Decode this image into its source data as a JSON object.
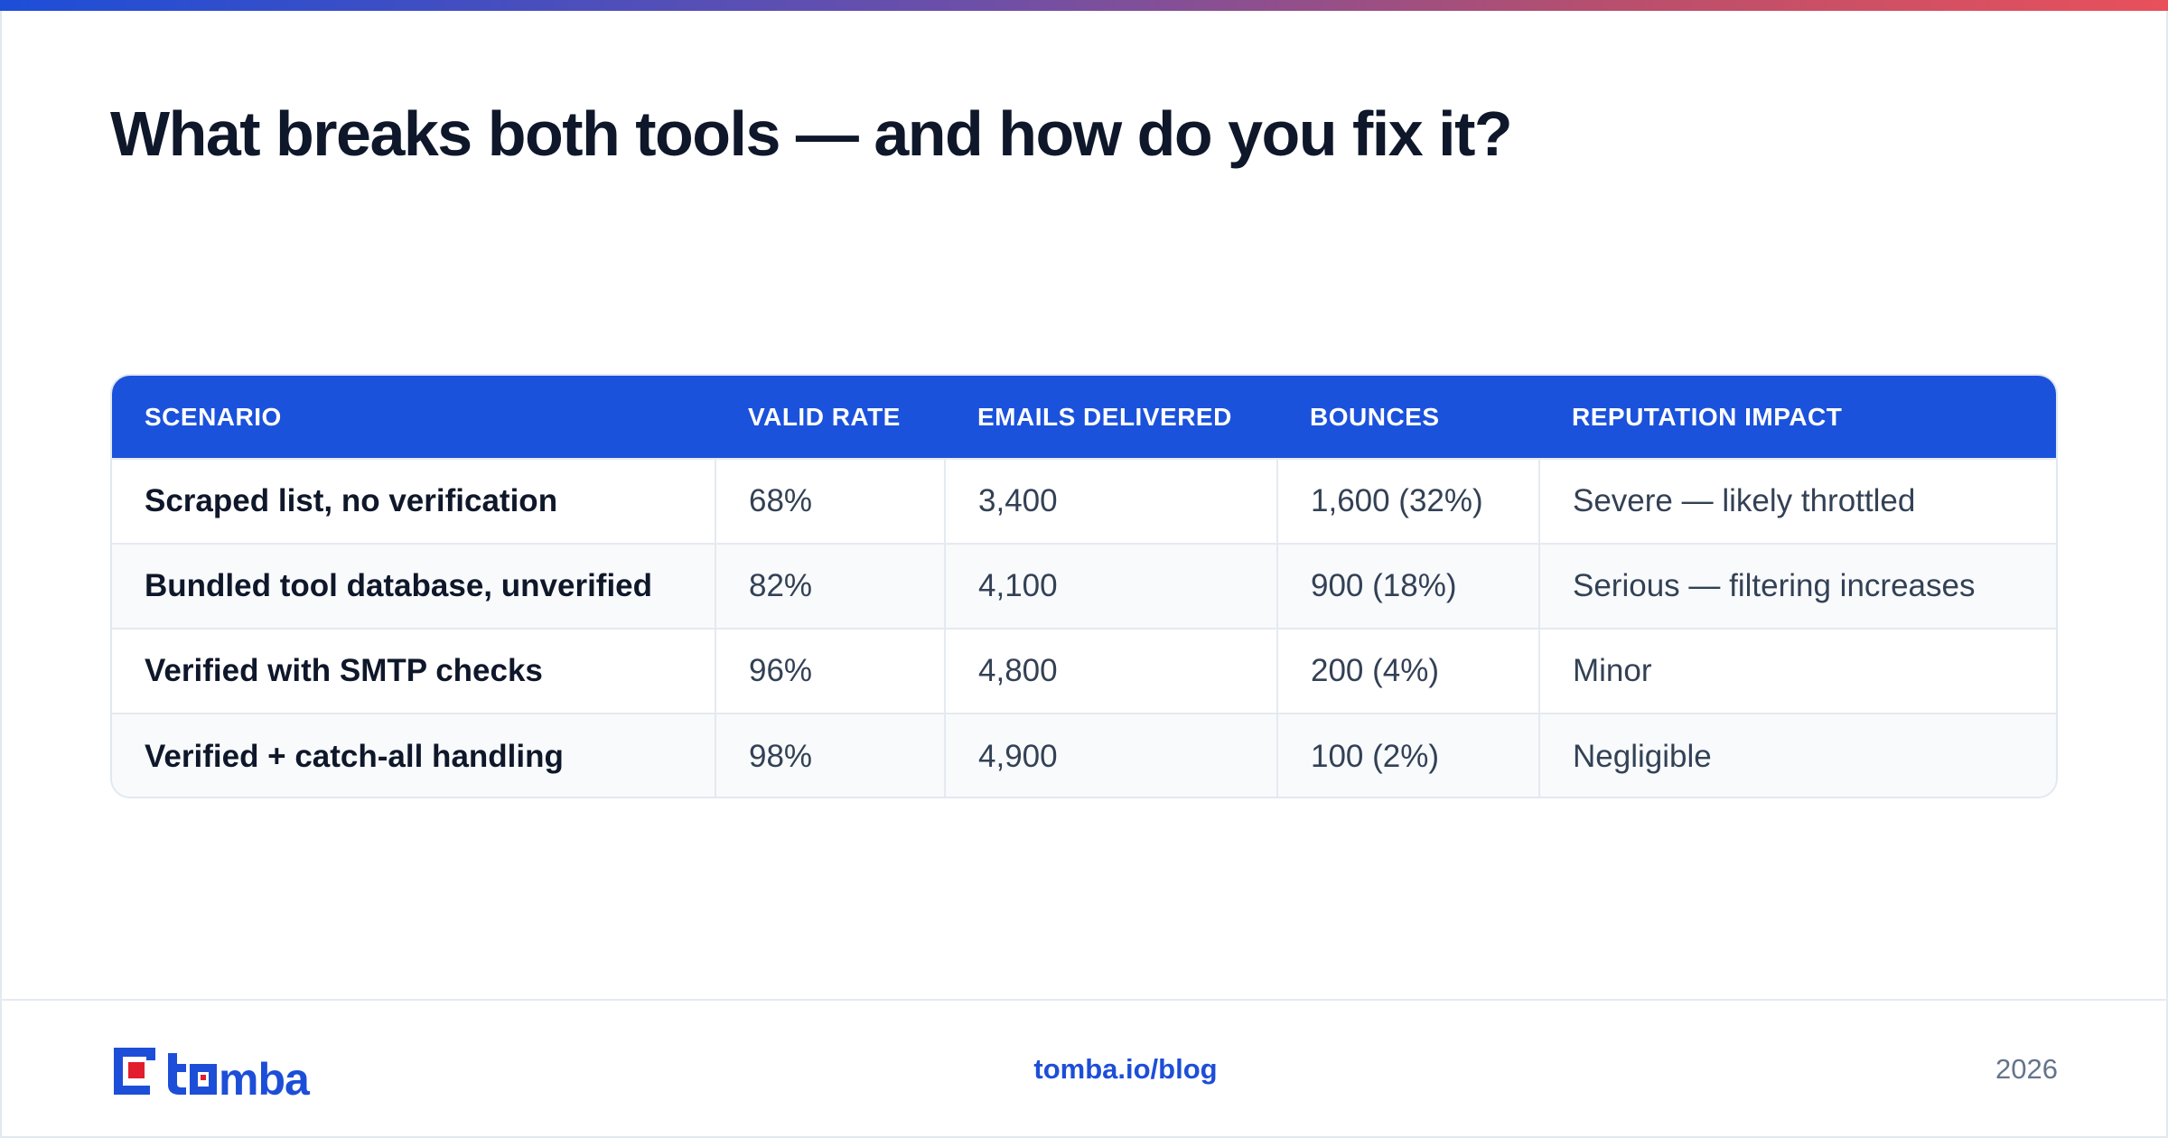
{
  "title": "What breaks both tools — and how do you fix it?",
  "table": {
    "headers": [
      "SCENARIO",
      "VALID RATE",
      "EMAILS DELIVERED",
      "BOUNCES",
      "REPUTATION IMPACT"
    ],
    "rows": [
      [
        "Scraped list, no verification",
        "68%",
        "3,400",
        "1,600 (32%)",
        "Severe — likely throttled"
      ],
      [
        "Bundled tool database, unverified",
        "82%",
        "4,100",
        "900 (18%)",
        "Serious — filtering increases"
      ],
      [
        "Verified with SMTP checks",
        "96%",
        "4,800",
        "200 (4%)",
        "Minor"
      ],
      [
        "Verified + catch-all handling",
        "98%",
        "4,900",
        "100 (2%)",
        "Negligible"
      ]
    ]
  },
  "footer": {
    "brand": "tomba",
    "link": "tomba.io/blog",
    "year": "2026"
  },
  "colors": {
    "header_bg": "#1b52dc",
    "brand_blue": "#1d4ed8",
    "brand_red": "#e11d2e"
  }
}
